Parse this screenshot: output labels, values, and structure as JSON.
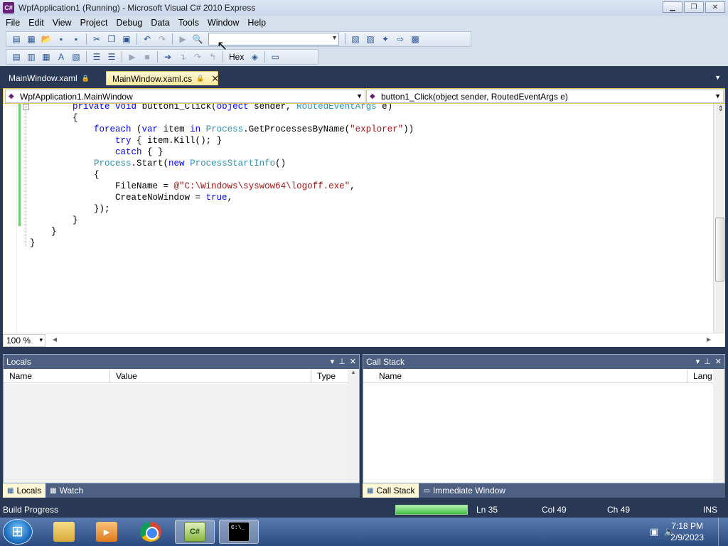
{
  "window": {
    "title": "WpfApplication1 (Running) - Microsoft Visual C# 2010 Express",
    "icon_label": "C#",
    "controls": [
      "minimize-icon",
      "maximize-icon",
      "close-icon"
    ]
  },
  "menu": [
    "File",
    "Edit",
    "View",
    "Project",
    "Debug",
    "Data",
    "Tools",
    "Window",
    "Help"
  ],
  "toolbar": {
    "config_combo_value": "",
    "hex_label": "Hex"
  },
  "doc_tabs": [
    {
      "label": "MainWindow.xaml",
      "active": false
    },
    {
      "label": "MainWindow.xaml.cs",
      "active": true
    }
  ],
  "nav": {
    "type_combo": "WpfApplication1.MainWindow",
    "member_combo": "button1_Click(object sender, RoutedEventArgs e)"
  },
  "editor": {
    "zoom": "100 %"
  },
  "locals": {
    "title": "Locals",
    "columns": [
      "Name",
      "Value",
      "Type"
    ],
    "tabs": [
      "Locals",
      "Watch"
    ]
  },
  "callstack": {
    "title": "Call Stack",
    "columns": [
      "Name",
      "Lang"
    ],
    "tabs": [
      "Call Stack",
      "Immediate Window"
    ]
  },
  "status": {
    "left": "Build Progress",
    "progress": 1.0,
    "ln": "Ln 35",
    "col": "Col 49",
    "ch": "Ch 49",
    "mode": "INS"
  },
  "taskbar": {
    "time": "7:18 PM",
    "date": "2/9/2023",
    "apps": [
      "folder-icon",
      "media-player-icon",
      "chrome-icon",
      "visual-csharp-icon",
      "command-prompt-icon"
    ],
    "vs_icon_label": "C#",
    "cmd_icon_label": "C:\\_"
  }
}
